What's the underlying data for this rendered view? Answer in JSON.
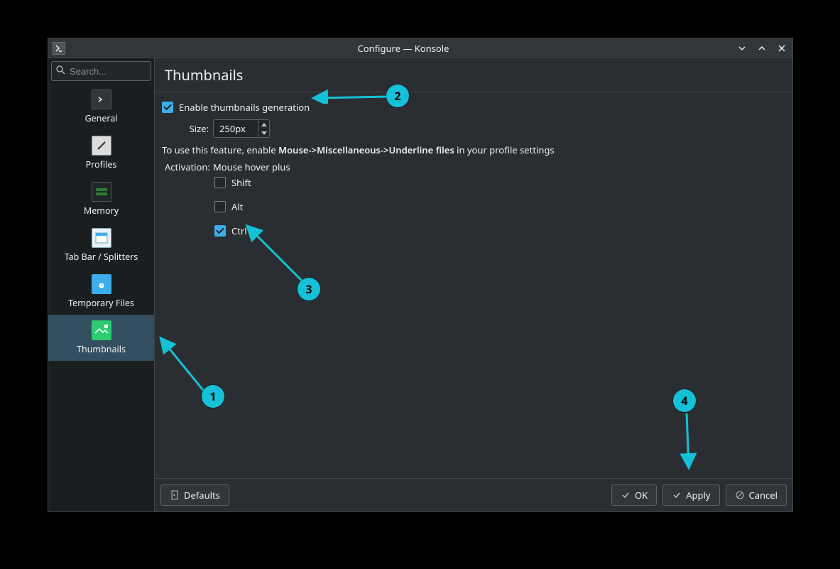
{
  "window": {
    "title": "Configure — Konsole"
  },
  "search": {
    "placeholder": "Search..."
  },
  "sidebar": {
    "items": [
      {
        "id": "general",
        "label": "General"
      },
      {
        "id": "profiles",
        "label": "Profiles"
      },
      {
        "id": "memory",
        "label": "Memory"
      },
      {
        "id": "tabbar",
        "label": "Tab Bar / Splitters"
      },
      {
        "id": "tempfiles",
        "label": "Temporary Files"
      },
      {
        "id": "thumbnails",
        "label": "Thumbnails"
      }
    ]
  },
  "page": {
    "title": "Thumbnails",
    "enable_label": "Enable thumbnails generation",
    "enable_checked": true,
    "size_label": "Size:",
    "size_value": "250px",
    "help_prefix": "To use this feature, enable ",
    "help_bold": "Mouse->Miscellaneous->Underline files",
    "help_suffix": " in your profile settings",
    "activation_label": "Activation:",
    "activation_value": "Mouse hover plus",
    "modifiers": [
      {
        "id": "shift",
        "label": "Shift",
        "checked": false
      },
      {
        "id": "alt",
        "label": "Alt",
        "checked": false
      },
      {
        "id": "ctrl",
        "label": "Ctrl",
        "checked": true
      }
    ]
  },
  "footer": {
    "defaults": "Defaults",
    "ok": "OK",
    "apply": "Apply",
    "cancel": "Cancel"
  },
  "annotations": {
    "1": "1",
    "2": "2",
    "3": "3",
    "4": "4"
  },
  "colors": {
    "accent": "#3daee9",
    "annotation": "#15c1d6"
  }
}
